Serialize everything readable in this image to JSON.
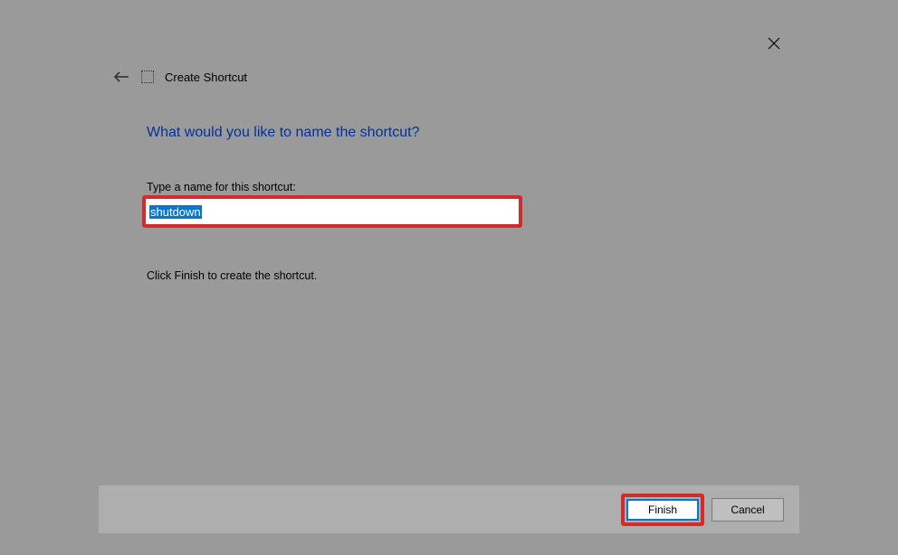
{
  "dialog": {
    "title": "Create Shortcut",
    "heading": "What would you like to name the shortcut?",
    "field_label": "Type a name for this shortcut:",
    "input_value": "shutdown",
    "instruction": "Click Finish to create the shortcut."
  },
  "buttons": {
    "finish": "Finish",
    "cancel": "Cancel"
  }
}
